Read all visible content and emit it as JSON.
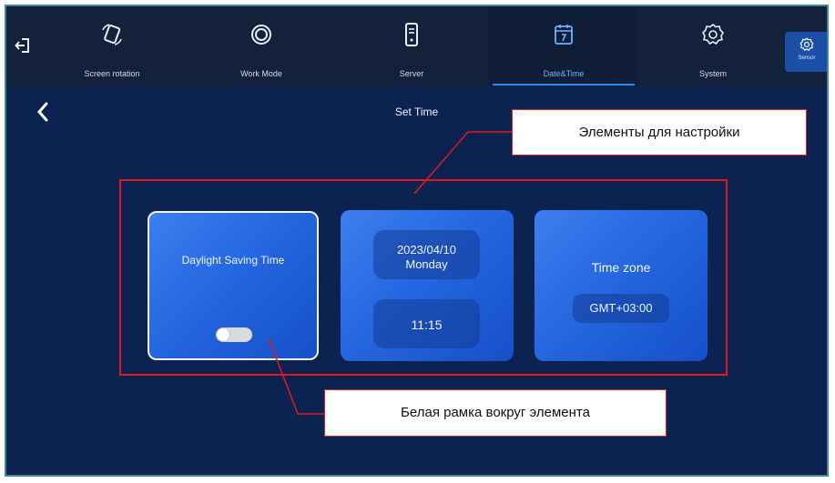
{
  "header": {
    "tabs": [
      {
        "label": "Screen rotation",
        "icon": "screen-rotation-icon"
      },
      {
        "label": "Work Mode",
        "icon": "work-mode-icon"
      },
      {
        "label": "Server",
        "icon": "server-icon"
      },
      {
        "label": "Date&Time",
        "icon": "calendar-icon",
        "active": true
      },
      {
        "label": "System",
        "icon": "gear-icon"
      }
    ],
    "sensor_label": "Sensor"
  },
  "page": {
    "title": "Set Time"
  },
  "cards": {
    "dst": {
      "label": "Daylight Saving Time",
      "enabled": false
    },
    "datetime": {
      "date": "2023/04/10",
      "weekday": "Monday",
      "time": "11:15"
    },
    "timezone": {
      "label": "Time zone",
      "value": "GMT+03:00"
    }
  },
  "annotations": {
    "top": "Элементы для настройки",
    "bottom": "Белая рамка вокруг элемента"
  },
  "colors": {
    "background": "#0c2250",
    "topbar": "#14213a",
    "card": "#2467e0",
    "accent": "#2b8cf7",
    "highlight_frame": "#e0191f"
  }
}
